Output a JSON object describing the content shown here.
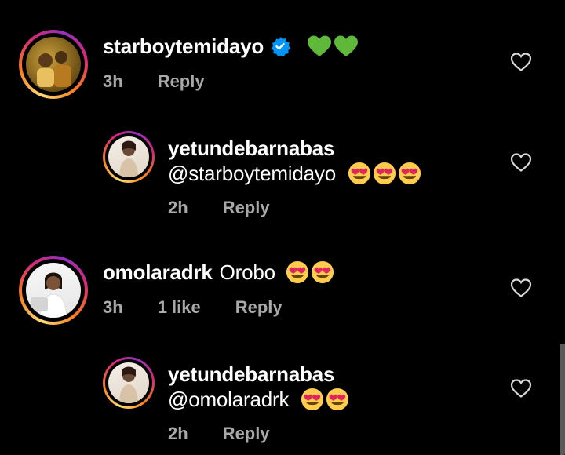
{
  "comments": [
    {
      "username": "starboytemidayo",
      "verified": true,
      "text": "💚💚",
      "time": "3h",
      "likes": "",
      "reply_label": "Reply"
    },
    {
      "username": "yetundebarnabas",
      "text": "@starboytemidayo",
      "emoji_count": 3,
      "time": "2h",
      "reply_label": "Reply"
    },
    {
      "username": "omolaradrk",
      "text": "Orobo",
      "emoji_count": 2,
      "time": "3h",
      "likes": "1 like",
      "reply_label": "Reply"
    },
    {
      "username": "yetundebarnabas",
      "text": "@omolaradrk",
      "emoji_count": 2,
      "time": "2h",
      "reply_label": "Reply"
    }
  ],
  "icons": {
    "like": "heart-outline-icon",
    "verified": "verified-badge-icon",
    "emoji": "heart-eyes-emoji"
  },
  "colors": {
    "background": "#000000",
    "meta_text": "#a8a8a8",
    "verified_blue": "#0095f6",
    "emoji_green": "#5fb83a"
  }
}
